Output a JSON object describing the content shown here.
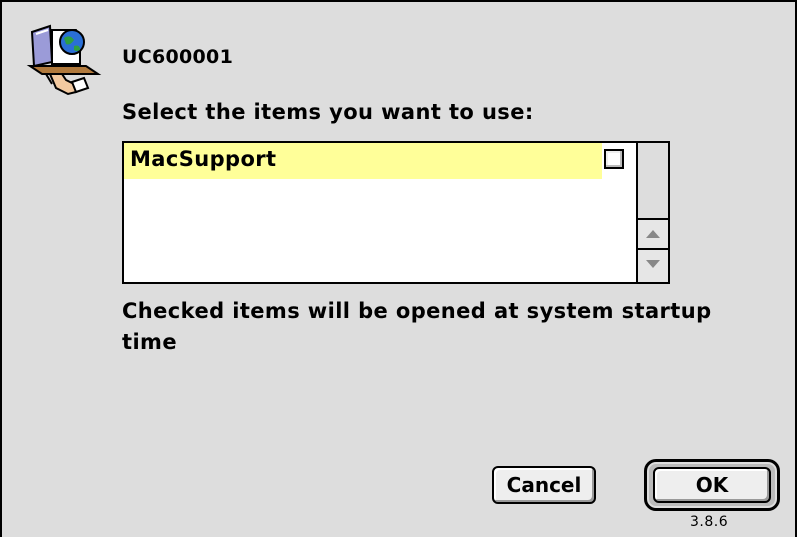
{
  "dialog": {
    "server_name": "UC600001",
    "prompt": "Select the items you want to use:",
    "items": [
      {
        "label": "MacSupport",
        "checked": false,
        "highlight_color": "#ffff99"
      }
    ],
    "note": "Checked items will be opened at system startup time",
    "buttons": {
      "cancel_label": "Cancel",
      "ok_label": "OK"
    },
    "version": "3.8.6",
    "icon": "chooser-server-icon"
  },
  "colors": {
    "background": "#dddddd",
    "selection": "#ffff99",
    "frame": "#000000"
  }
}
